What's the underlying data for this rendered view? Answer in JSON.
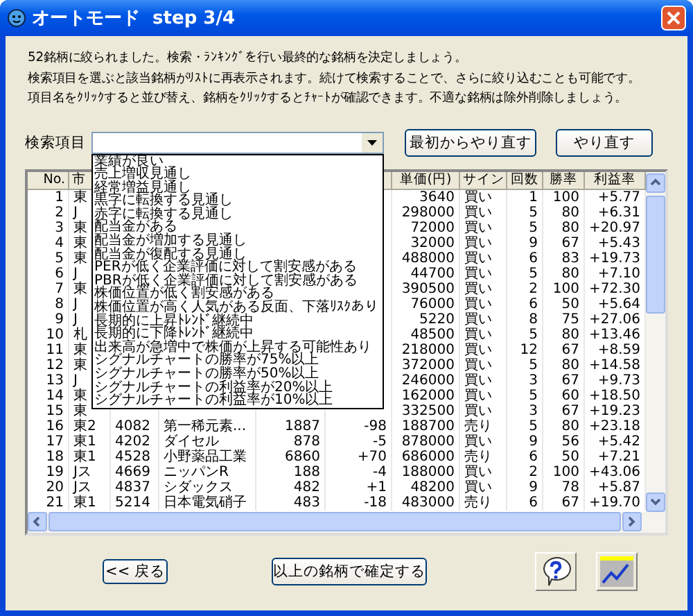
{
  "window": {
    "title": "オートモード  step 3/4"
  },
  "description": [
    "52銘柄に絞られました。検索・ﾗﾝｷﾝｸﾞを行い最終的な銘柄を決定しましょう。",
    "検索項目を選ぶと該当銘柄がﾘｽﾄに再表示されます。続けて検索することで、さらに絞り込むことも可能です。",
    "項目名をｸﾘｯｸすると並び替え、銘柄をｸﾘｯｸするとﾁｬｰﾄが確認できます。不適な銘柄は除外削除しましょう。"
  ],
  "search": {
    "label": "検索項目",
    "expanded": true,
    "options": [
      "業績が良い",
      "売上増収見通し",
      "経常増益見通し",
      "黒字に転換する見通し",
      "赤字に転換する見通し",
      "配当金がある",
      "配当金が増加する見通し",
      "配当金が復配する見通し",
      "PERが低く企業評価に対して割安感がある",
      "PBRが低く企業評価に対して割安感がある",
      "株価位置が低く割安感がある",
      "株価位置が高く人気がある反面、下落ﾘｽｸあり",
      "長期的に上昇ﾄﾚﾝﾄﾞ継続中",
      "長期的に下降ﾄﾚﾝﾄﾞ継続中",
      "出来高が急増中で株価が上昇する可能性あり",
      "シグナルチャートの勝率が75%以上",
      "シグナルチャートの勝率が50%以上",
      "シグナルチャートの利益率が20%以上",
      "シグナルチャートの利益率が10%以上"
    ]
  },
  "top_buttons": [
    "最初からやり直す",
    "やり直す"
  ],
  "table": {
    "columns": [
      "No.",
      "市",
      null,
      null,
      null,
      null,
      "単価(円)",
      "サイン",
      "回数",
      "勝率",
      "利益率"
    ],
    "rows": [
      [
        "1",
        "東",
        null,
        null,
        null,
        null,
        "3640",
        "買い",
        "1",
        "100",
        "+5.77"
      ],
      [
        "2",
        "J",
        null,
        null,
        null,
        null,
        "298000",
        "買い",
        "5",
        "80",
        "+6.31"
      ],
      [
        "3",
        "東",
        null,
        null,
        null,
        null,
        "72000",
        "買い",
        "5",
        "80",
        "+20.97"
      ],
      [
        "4",
        "東",
        null,
        null,
        null,
        null,
        "32000",
        "買い",
        "9",
        "67",
        "+5.43"
      ],
      [
        "5",
        "東",
        null,
        null,
        null,
        null,
        "488000",
        "買い",
        "6",
        "83",
        "+19.73"
      ],
      [
        "6",
        "J",
        null,
        null,
        null,
        null,
        "44700",
        "買い",
        "5",
        "80",
        "+7.10"
      ],
      [
        "7",
        "東",
        null,
        null,
        null,
        null,
        "390500",
        "買い",
        "2",
        "100",
        "+72.30"
      ],
      [
        "8",
        "J",
        null,
        null,
        null,
        null,
        "76000",
        "買い",
        "6",
        "50",
        "+5.64"
      ],
      [
        "9",
        "J",
        null,
        null,
        null,
        null,
        "5220",
        "買い",
        "8",
        "75",
        "+27.06"
      ],
      [
        "10",
        "札",
        null,
        null,
        null,
        null,
        "48500",
        "買い",
        "5",
        "80",
        "+13.46"
      ],
      [
        "11",
        "東",
        null,
        null,
        null,
        null,
        "218000",
        "買い",
        "12",
        "67",
        "+8.59"
      ],
      [
        "12",
        "東",
        null,
        null,
        null,
        null,
        "372000",
        "買い",
        "5",
        "80",
        "+14.58"
      ],
      [
        "13",
        "J",
        null,
        null,
        null,
        null,
        "246000",
        "買い",
        "3",
        "67",
        "+9.73"
      ],
      [
        "14",
        "東",
        null,
        null,
        null,
        null,
        "162000",
        "買い",
        "5",
        "60",
        "+18.50"
      ],
      [
        "15",
        "東",
        null,
        null,
        null,
        null,
        "332500",
        "買い",
        "3",
        "67",
        "+19.23"
      ],
      [
        "16",
        "東2",
        "4082",
        "第一稀元素...",
        "1887",
        "-98",
        "188700",
        "売り",
        "5",
        "80",
        "+23.18"
      ],
      [
        "17",
        "東1",
        "4202",
        "ダイセル",
        "878",
        "-5",
        "878000",
        "買い",
        "9",
        "56",
        "+5.42"
      ],
      [
        "18",
        "東1",
        "4528",
        "小野薬品工業",
        "6860",
        "+70",
        "686000",
        "売り",
        "6",
        "50",
        "+7.21"
      ],
      [
        "19",
        "Jス",
        "4669",
        "ニッパンR",
        "188",
        "-4",
        "188000",
        "買い",
        "2",
        "100",
        "+43.06"
      ],
      [
        "20",
        "Jス",
        "4837",
        "シダックス",
        "482",
        "+1",
        "48200",
        "買い",
        "9",
        "78",
        "+5.87"
      ],
      [
        "21",
        "東1",
        "5214",
        "日本電気硝子",
        "483",
        "-18",
        "483000",
        "売り",
        "6",
        "67",
        "+19.70"
      ]
    ]
  },
  "bottom_buttons": {
    "back": "<< 戻る",
    "confirm": "以上の銘柄で確定する"
  }
}
